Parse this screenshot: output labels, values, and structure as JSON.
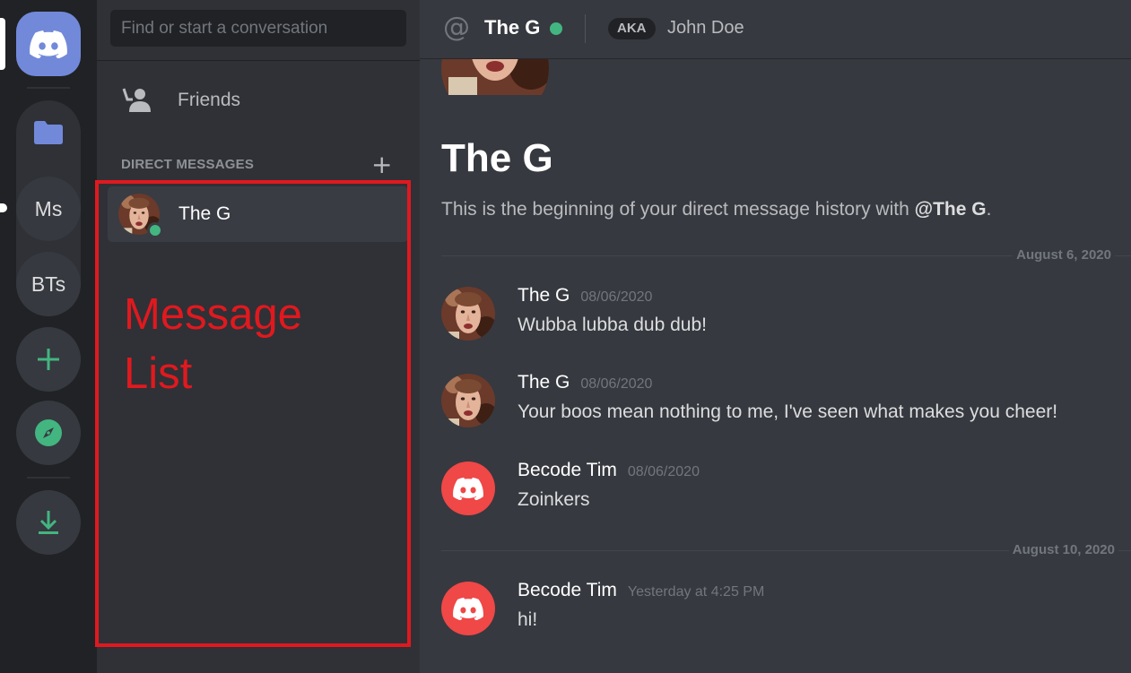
{
  "rail": {
    "servers": [
      {
        "label": "Ms"
      },
      {
        "label": "BTs"
      }
    ],
    "icons": {
      "home": "discord-logo-icon",
      "folder": "folder-icon",
      "add": "plus-icon",
      "explore": "compass-icon",
      "download": "download-icon"
    },
    "colors": {
      "brand": "#7289da",
      "folder": "#7289da",
      "green": "#43b581"
    }
  },
  "dm_column": {
    "search_placeholder": "Find or start a conversation",
    "friends_label": "Friends",
    "direct_messages_header": "DIRECT MESSAGES",
    "add_dm_glyph": "+",
    "items": [
      {
        "name": "The G",
        "status": "online"
      }
    ]
  },
  "annotation": {
    "label_line1": "Message",
    "label_line2": "List",
    "color": "#e0191f"
  },
  "header": {
    "at_glyph": "@",
    "name": "The G",
    "aka_badge": "AKA",
    "aka_name": "John Doe"
  },
  "intro": {
    "title": "The G",
    "subtitle_prefix": "This is the beginning of your direct message history with ",
    "subtitle_handle": "@The G",
    "subtitle_suffix": "."
  },
  "dividers": [
    {
      "label": "August 6, 2020"
    },
    {
      "label": "August 10, 2020"
    }
  ],
  "messages": [
    {
      "author": "The G",
      "time": "08/06/2020",
      "text": "Wubba lubba dub dub!",
      "avatar": "photo"
    },
    {
      "author": "The G",
      "time": "08/06/2020",
      "text": "Your boos mean nothing to me, I've seen what makes you cheer!",
      "avatar": "photo"
    },
    {
      "author": "Becode Tim",
      "time": "08/06/2020",
      "text": "Zoinkers",
      "avatar": "discord-logo-icon"
    },
    {
      "author": "Becode Tim",
      "time": "Yesterday at 4:25 PM",
      "text": "hi!",
      "avatar": "discord-logo-icon"
    }
  ]
}
